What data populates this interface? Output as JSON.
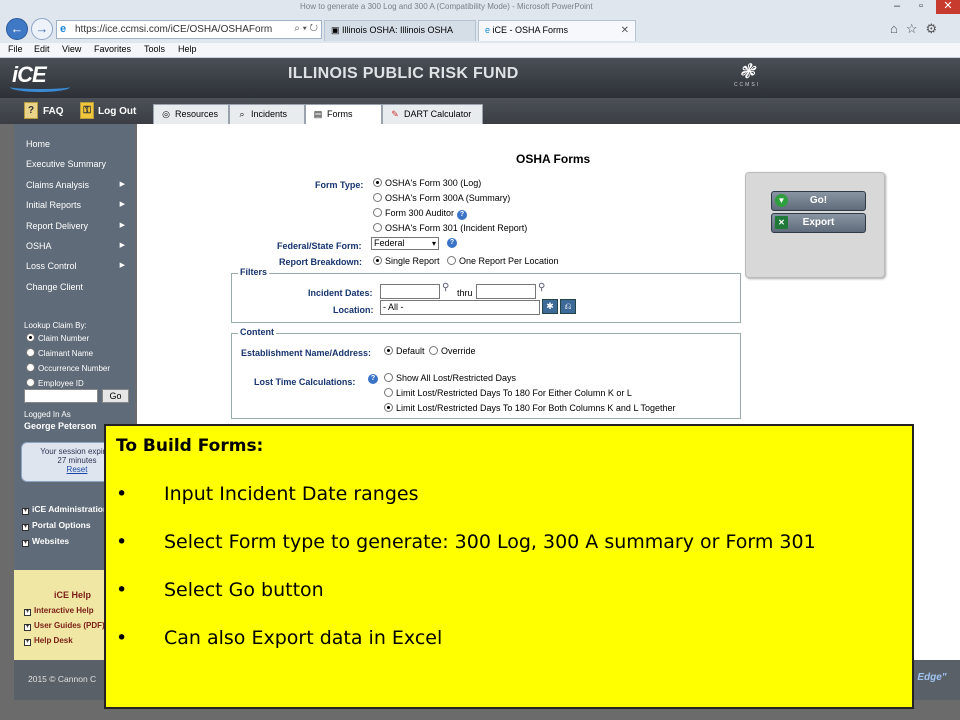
{
  "window": {
    "title": "How to generate a 300 Log and 300 A (Compatibility Mode) - Microsoft PowerPoint"
  },
  "browser": {
    "url": "https://ice.ccmsi.com/iCE/OSHA/OSHAForm",
    "tabs": [
      {
        "label": "Illinois OSHA: Illinois OSHA"
      },
      {
        "label": "iCE - OSHA Forms"
      }
    ],
    "menu": [
      "File",
      "Edit",
      "View",
      "Favorites",
      "Tools",
      "Help"
    ]
  },
  "header": {
    "logo": "iCE",
    "org_title": "ILLINOIS PUBLIC RISK FUND",
    "company_logo": "CCMSI"
  },
  "toolbar": {
    "faq": "FAQ",
    "logout": "Log Out",
    "tabs": [
      {
        "label": "Resources"
      },
      {
        "label": "Incidents"
      },
      {
        "label": "Forms"
      },
      {
        "label": "DART Calculator"
      }
    ]
  },
  "sidebar": {
    "items": [
      {
        "label": "Home"
      },
      {
        "label": "Executive Summary"
      },
      {
        "label": "Claims Analysis"
      },
      {
        "label": "Initial Reports"
      },
      {
        "label": "Report Delivery"
      },
      {
        "label": "OSHA"
      },
      {
        "label": "Loss Control"
      },
      {
        "label": "Change Client"
      }
    ],
    "lookup": {
      "label": "Lookup Claim By:",
      "options": [
        "Claim Number",
        "Claimant Name",
        "Occurrence Number",
        "Employee ID"
      ],
      "go": "Go"
    },
    "logged_in_label": "Logged In As",
    "user": "George Peterson",
    "session": {
      "line1": "Your session expires",
      "line2": "27 minutes",
      "reset": "Reset"
    },
    "links": [
      "iCE Administration",
      "Portal Options",
      "Websites"
    ],
    "help": {
      "title": "iCE Help",
      "links": [
        "Interactive Help",
        "User Guides (PDF)",
        "Help Desk"
      ]
    }
  },
  "form": {
    "title": "OSHA Forms",
    "form_type_label": "Form Type:",
    "form_types": [
      "OSHA's Form 300 (Log)",
      "OSHA's Form 300A (Summary)",
      "Form 300 Auditor",
      "OSHA's Form 301 (Incident Report)"
    ],
    "federal_state_label": "Federal/State Form:",
    "federal_state_value": "Federal",
    "breakdown_label": "Report Breakdown:",
    "breakdown_options": [
      "Single Report",
      "One Report Per Location"
    ],
    "filters_legend": "Filters",
    "incident_dates_label": "Incident Dates:",
    "thru": "thru",
    "location_label": "Location:",
    "location_value": "- All -",
    "content_legend": "Content",
    "establishment_label": "Establishment Name/Address:",
    "establishment_options": [
      "Default",
      "Override"
    ],
    "lost_time_label": "Lost Time Calculations:",
    "lost_time_options": [
      "Show All Lost/Restricted Days",
      "Limit Lost/Restricted Days To 180 For Either Column K or L",
      "Limit Lost/Restricted Days To 180 For Both Columns K and L Together"
    ],
    "go_button": "Go!",
    "export_button": "Export"
  },
  "footer": {
    "copyright": "2015 © Cannon C",
    "slogan": "s Edge\""
  },
  "callout": {
    "title": "To Build Forms:",
    "items": [
      "Input Incident Date ranges",
      "Select Form type to generate: 300 Log, 300 A summary or Form 301",
      "Select Go button",
      "Can also Export data in Excel"
    ]
  }
}
